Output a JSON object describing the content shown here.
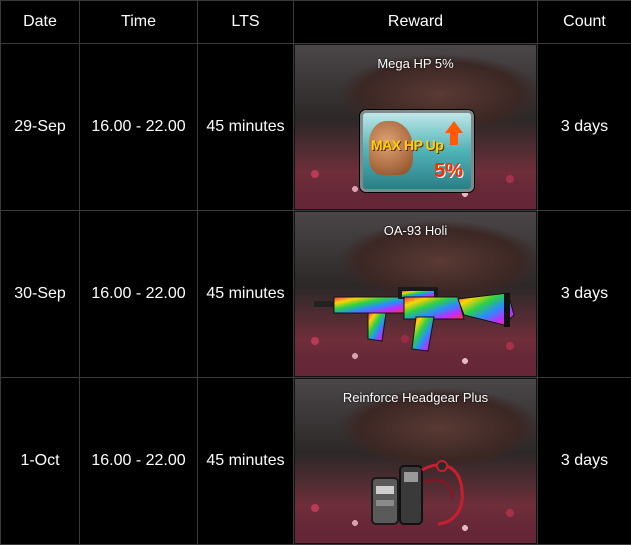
{
  "table": {
    "headers": [
      "Date",
      "Time",
      "LTS",
      "Reward",
      "Count"
    ],
    "rows": [
      {
        "date": "29-Sep",
        "time": "16.00 - 22.00",
        "lts": "45 minutes",
        "reward": "Mega HP 5%",
        "reward_badge_text": "MAX HP Up",
        "reward_badge_pct": "5%",
        "count": "3 days"
      },
      {
        "date": "30-Sep",
        "time": "16.00 - 22.00",
        "lts": "45 minutes",
        "reward": "OA-93 Holi",
        "count": "3 days"
      },
      {
        "date": "1-Oct",
        "time": "16.00 - 22.00",
        "lts": "45 minutes",
        "reward": "Reinforce Headgear Plus",
        "count": "3 days"
      }
    ]
  },
  "colors": {
    "background": "#000000",
    "grid": "#3a3a3a",
    "text": "#ffffff"
  }
}
